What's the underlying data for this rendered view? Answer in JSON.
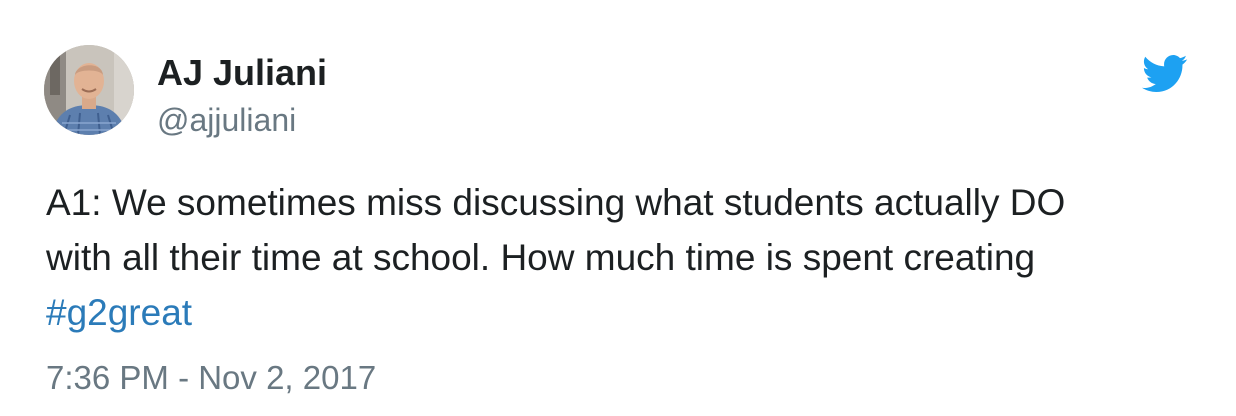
{
  "author": {
    "display_name": "AJ Juliani",
    "handle": "@ajjuliani"
  },
  "tweet": {
    "lines": [
      "A1: We sometimes miss discussing what students actually DO",
      "with all their time at school. How much time is spent creating"
    ],
    "hashtag": "#g2great",
    "timestamp": "7:36 PM - Nov 2, 2017"
  },
  "icons": {
    "brand": "twitter-bird-icon",
    "avatar": "profile-photo"
  },
  "colors": {
    "text": "#1c2022",
    "muted": "#697882",
    "link": "#2b7bb9",
    "twitter_blue": "#1da1f2"
  }
}
